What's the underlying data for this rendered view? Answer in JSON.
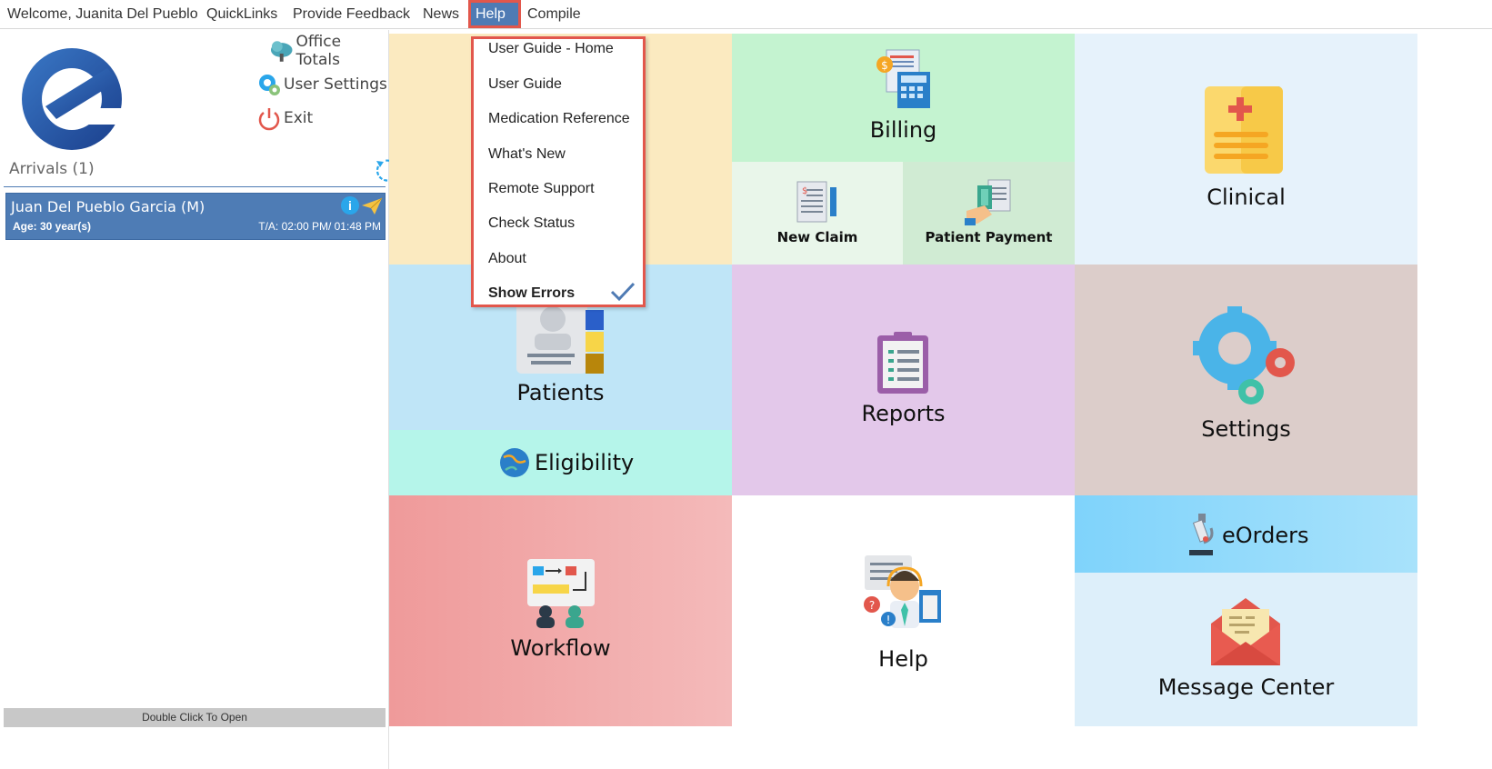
{
  "menubar": {
    "welcome": "Welcome, Juanita Del Pueblo",
    "quicklinks": "QuickLinks",
    "feedback": "Provide Feedback",
    "news": "News",
    "help": "Help",
    "compile": "Compile"
  },
  "help_menu": {
    "items": [
      "User Guide - Home",
      "User Guide",
      "Medication Reference",
      "What's New",
      "Remote Support",
      "Check Status",
      "About"
    ],
    "show_errors": "Show Errors"
  },
  "quick_links": {
    "office_totals": "Office Totals",
    "user_settings": "User Settings",
    "exit": "Exit"
  },
  "arrivals": {
    "title": "Arrivals (1)",
    "patient": {
      "name": "Juan Del Pueblo Garcia (M)",
      "age": "Age: 30 year(s)",
      "ta": "T/A: 02:00 PM/ 01:48 PM"
    },
    "footer": "Double Click To Open"
  },
  "tiles": {
    "billing": "Billing",
    "new_claim": "New Claim",
    "patient_payment": "Patient Payment",
    "clinical": "Clinical",
    "patients": "Patients",
    "eligibility": "Eligibility",
    "reports": "Reports",
    "settings": "Settings",
    "workflow": "Workflow",
    "help": "Help",
    "eorders": "eOrders",
    "message_center": "Message Center"
  },
  "colors": {
    "accent": "#4f7bb4",
    "highlight": "#e2574c"
  }
}
